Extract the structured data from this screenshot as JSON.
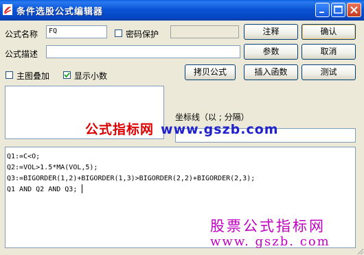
{
  "window": {
    "title": "条件选股公式编辑器",
    "controls": {
      "minimize": "minimize-icon",
      "maximize": "maximize-icon",
      "close": "close-icon"
    }
  },
  "form": {
    "name_label": "公式名称",
    "name_value": "FQ",
    "password_label": "密码保护",
    "password_checked": false,
    "desc_label": "公式描述",
    "desc_value": "",
    "overlay_label": "主图叠加",
    "overlay_checked": false,
    "decimals_label": "显示小数",
    "decimals_checked": true,
    "coord_label": "坐标线（以 ; 分隔）",
    "coord_value": ""
  },
  "buttons": {
    "comment": "注释",
    "ok": "确认",
    "params": "参数",
    "cancel": "取消",
    "copy": "拷贝公式",
    "insert": "插入函数",
    "test": "测试"
  },
  "code": [
    "Q1:=C<O;",
    "Q2:=VOL>1.5*MA(VOL,5);",
    "Q3:=BIGORDER(1,2)+BIGORDER(1,3)>BIGORDER(2,2)+BIGORDER(2,3);",
    "Q1 AND Q2 AND Q3;"
  ],
  "watermarks": {
    "top_cn": "公式指标网",
    "top_en": "www.gszb.com",
    "bottom_cn": "股票公式指标网",
    "bottom_en": "www. gszb. com"
  },
  "colors": {
    "title_bar": "#0646c3",
    "watermark_red": "#dd0000",
    "watermark_blue": "#2222cc",
    "watermark_magenta": "#c000c0"
  }
}
